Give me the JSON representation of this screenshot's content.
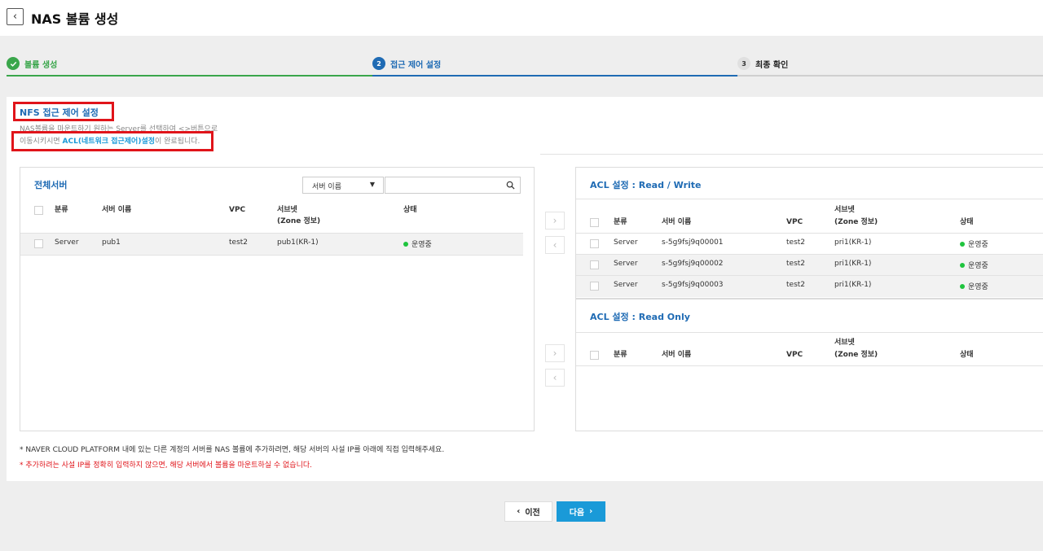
{
  "header": {
    "title": "NAS 볼륨 생성"
  },
  "steps": [
    {
      "num": "",
      "label": "볼륨 생성"
    },
    {
      "num": "2",
      "label": "접근 제어 설정"
    },
    {
      "num": "3",
      "label": "최종 확인"
    }
  ],
  "section": {
    "title": "NFS 접근 제어 설정",
    "desc_line1": "NAS볼륨을 마운트하기 원하는 Server를 선택하여 <>버튼으로",
    "desc_line2_pre": "이동시키시면 ",
    "desc_line2_link": "ACL(네트워크 접근제어)설정",
    "desc_line2_post": "이 완료됩니다."
  },
  "all_servers": {
    "title": "전체서버",
    "filter_selected": "서버 이름",
    "search_value": "",
    "columns": {
      "category": "분류",
      "name": "서버 이름",
      "vpc": "VPC",
      "subnet1": "서브넷",
      "subnet2": "(Zone 정보)",
      "status": "상태"
    },
    "rows": [
      {
        "category": "Server",
        "name": "pub1",
        "vpc": "test2",
        "subnet": "pub1(KR-1)",
        "status": "운영중"
      }
    ]
  },
  "acl_rw": {
    "title": "ACL 설정 : Read / Write",
    "columns": {
      "category": "분류",
      "name": "서버 이름",
      "vpc": "VPC",
      "subnet1": "서브넷",
      "subnet2": "(Zone 정보)",
      "status": "상태"
    },
    "rows": [
      {
        "category": "Server",
        "name": "s-5g9fsj9q00001",
        "vpc": "test2",
        "subnet": "pri1(KR-1)",
        "status": "운영중"
      },
      {
        "category": "Server",
        "name": "s-5g9fsj9q00002",
        "vpc": "test2",
        "subnet": "pri1(KR-1)",
        "status": "운영중"
      },
      {
        "category": "Server",
        "name": "s-5g9fsj9q00003",
        "vpc": "test2",
        "subnet": "pri1(KR-1)",
        "status": "운영중"
      }
    ]
  },
  "acl_ro": {
    "title": "ACL 설정 : Read Only",
    "columns": {
      "category": "분류",
      "name": "서버 이름",
      "vpc": "VPC",
      "subnet1": "서브넷",
      "subnet2": "(Zone 정보)",
      "status": "상태"
    }
  },
  "notes": {
    "note1": "* NAVER CLOUD PLATFORM 내에 있는 다른 계정의 서버를 NAS 볼륨에 추가하려면, 해당 서버의 사설 IP를 아래에 직접 입력해주세요.",
    "note2": "* 추가하려는 사설 IP를 정확히 입력하지 않으면, 해당 서버에서 볼륨을 마운트하실 수 없습니다."
  },
  "footer": {
    "prev_label": "이전",
    "next_label": "다음"
  },
  "colors": {
    "accent": "#1f6bb4",
    "success": "#3aa64b",
    "primary_button": "#1a9ad8",
    "highlight": "#e0141a",
    "status_dot": "#1fc43e"
  }
}
